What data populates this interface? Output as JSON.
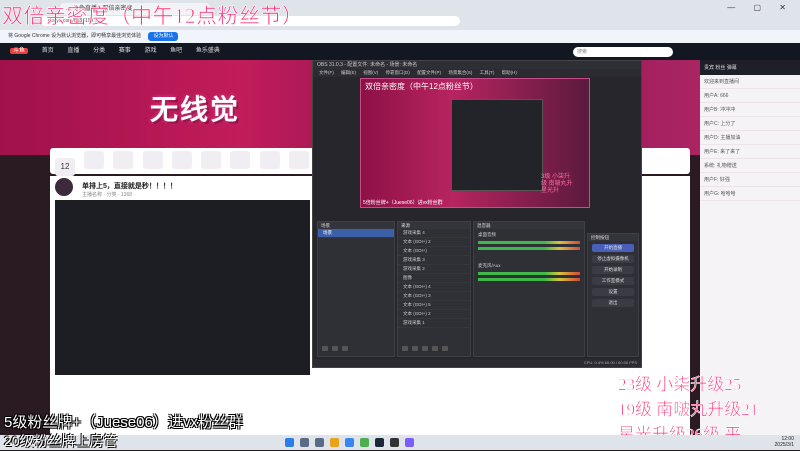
{
  "browser": {
    "tab_title": "...-斗鱼直播 - 双倍亲密度",
    "address": "douyu.com/6188199...",
    "infobar_text": "将 Google Chrome 设为默认浏览器，即可畅享最佳浏览体验",
    "infobar_button": "设为默认",
    "window_controls": "— ▢ ✕"
  },
  "site": {
    "logo": "斗鱼",
    "nav": [
      "首页",
      "直播",
      "分类",
      "赛事",
      "游戏",
      "鱼吧",
      "鱼乐盛典"
    ],
    "search_placeholder": "搜索",
    "banner_title": "无线觉"
  },
  "room": {
    "follow_count": "12",
    "title": "单排上5，直接就是秒！！！！",
    "meta": "主播名称 · 分类 · 1368"
  },
  "obs": {
    "title": "OBS 31.0.3 - 配置文件: 未命名 - 场景: 未命名",
    "menu": [
      "文件(F)",
      "编辑(E)",
      "视图(V)",
      "停靠窗口(D)",
      "配置文件(P)",
      "场景集合(S)",
      "工具(T)",
      "帮助(H)"
    ],
    "scenes_header": "场景",
    "scenes": [
      "场景"
    ],
    "sources_header": "来源",
    "sources": [
      "游戏采集 4",
      "文本 (GDI+) 2",
      "文本 (GDI+)",
      "游戏采集 3",
      "游戏采集 2",
      "图像",
      "文本 (GDI+) 4",
      "文本 (GDI+) 3",
      "文本 (GDI+) 5",
      "文本 (GDI+) 2",
      "游戏采集 1"
    ],
    "mixer_header": "混音器",
    "mixer": [
      "桌面音频",
      "麦克风/Aux"
    ],
    "controls_header": "控制按钮",
    "controls": [
      "开始直播",
      "停止虚拟摄像机",
      "开始录制",
      "工作室模式",
      "设置",
      "退出"
    ],
    "status": "CPU: 0.4%  60.00 / 60.00 FPS",
    "preview_title": "双倍亲密度（中午12点粉丝节）",
    "preview_text": "5倍粉丝牌+（Juese06）进vx粉丝群",
    "preview_right": [
      "3级 小柒升",
      "级 南啵丸升",
      "星光升"
    ]
  },
  "chat": {
    "header": "贵宾 粉丝 弹幕",
    "lines": [
      "欢迎来到直播间",
      "用户A: 666",
      "用户B: 冲冲冲",
      "用户C: 上分了",
      "用户D: 主播加油",
      "用户E: 来了来了",
      "系统: 礼物赠送",
      "用户F: 好强",
      "用户G: 哈哈哈"
    ]
  },
  "overlays": {
    "top": "双倍亲密度（中午12点粉丝节）",
    "bottom_left_1": "5级粉丝牌+（Juese06）进vx粉丝群",
    "bottom_left_2": "20级粉丝牌上房管",
    "bottom_right": [
      "23级 小柒升级25",
      "19级 南啵丸升级21",
      "星光升级26级 平"
    ]
  },
  "taskbar": {
    "time": "12:00",
    "date": "2025/3/1"
  }
}
